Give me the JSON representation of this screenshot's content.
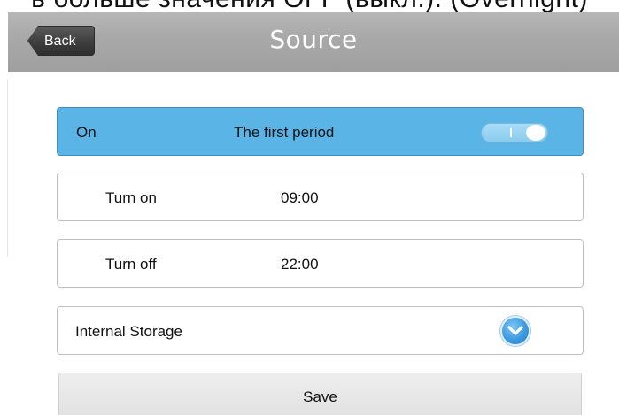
{
  "caption": "ь больше значения OFF (выкл.). (Overnight)",
  "header": {
    "back_label": "Back",
    "title": "Source"
  },
  "period": {
    "state_label": "On",
    "name": "The first period",
    "toggle_on": true
  },
  "turn_on": {
    "label": "Turn on",
    "value": "09:00"
  },
  "turn_off": {
    "label": "Turn off",
    "value": "22:00"
  },
  "storage": {
    "label": "Internal Storage",
    "icon": "chevron-down-icon"
  },
  "save_label": "Save",
  "colors": {
    "accent": "#5bb4e6",
    "titlebar": "#a9a9a9"
  }
}
